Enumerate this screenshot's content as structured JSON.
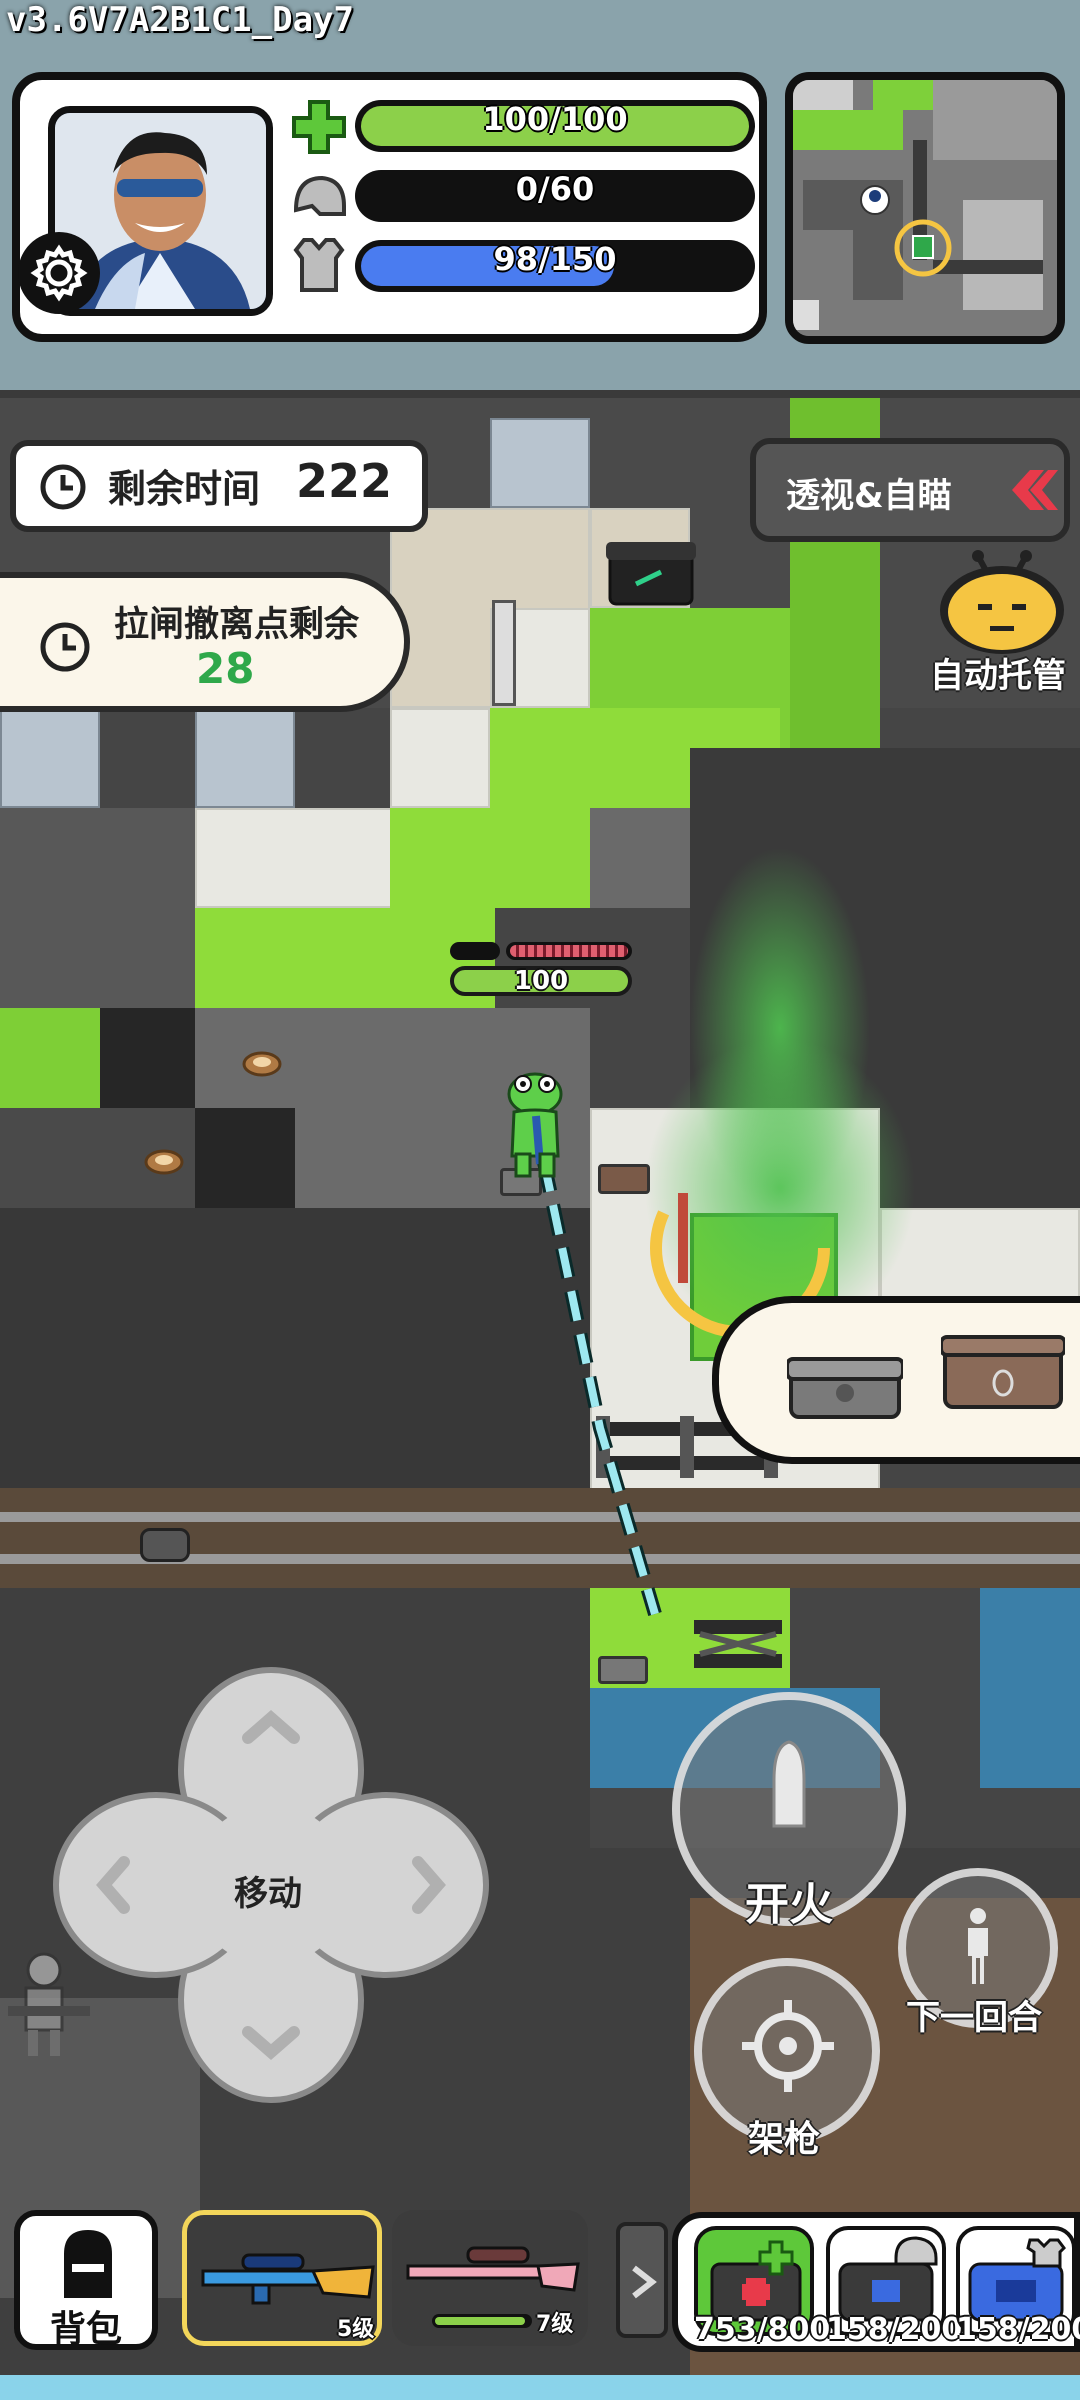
{
  "version": "v3.6V7A2B1C1_Day7",
  "stats": {
    "health": {
      "text": "100/100",
      "fraction": 1.0,
      "color": "#8cd04a"
    },
    "helmet": {
      "text": "0/60",
      "fraction": 0.0,
      "color": "#8cd04a"
    },
    "armor": {
      "text": "98/150",
      "fraction": 0.653,
      "color": "#4a7cf0"
    }
  },
  "timer": {
    "label": "剩余时间",
    "value": "222"
  },
  "extract": {
    "label": "拉闸撤离点剩余",
    "value": "28"
  },
  "xray_button": {
    "label": "透视&自瞄"
  },
  "auto_button": {
    "label": "自动托管"
  },
  "player": {
    "health_value": "100"
  },
  "controls": {
    "move_label": "移动",
    "fire_label": "开火",
    "next_round_label": "下一回合",
    "mount_label": "架枪"
  },
  "bottom_bar": {
    "backpack_label": "背包",
    "weapons": [
      {
        "level": "5级",
        "selected": true
      },
      {
        "level": "7级",
        "selected": false
      }
    ],
    "items": [
      {
        "count": "753/800",
        "icon": "medkit-icon"
      },
      {
        "count": "158/200",
        "icon": "helmet-repair-icon"
      },
      {
        "count": "158/200",
        "icon": "armor-repair-icon"
      }
    ]
  },
  "colors": {
    "grass": "#8fdc3a",
    "gas": "#5ac85a",
    "aim_line": "#9ee8f0",
    "extract_value": "#2fa84a"
  }
}
